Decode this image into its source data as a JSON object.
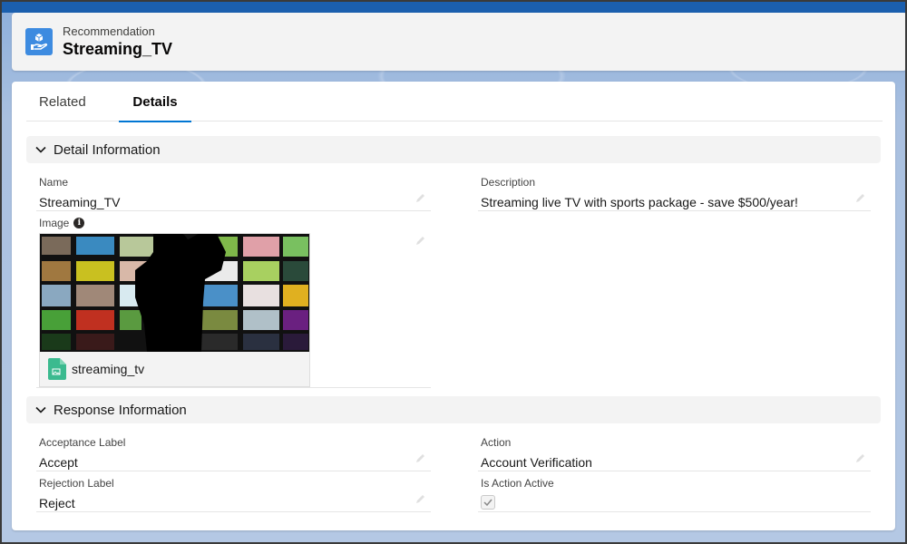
{
  "header": {
    "object_type": "Recommendation",
    "record_name": "Streaming_TV",
    "icon": "recommendation-icon",
    "icon_color": "#3d8be0"
  },
  "tabs": [
    {
      "label": "Related",
      "active": false
    },
    {
      "label": "Details",
      "active": true
    }
  ],
  "sections": {
    "detail": {
      "title": "Detail Information",
      "fields": {
        "name": {
          "label": "Name",
          "value": "Streaming_TV"
        },
        "description": {
          "label": "Description",
          "value": "Streaming live TV with sports package - save $500/year!"
        },
        "image": {
          "label": "Image",
          "info_icon": "info-icon",
          "file_name": "streaming_tv",
          "file_icon": "image-file-icon"
        }
      }
    },
    "response": {
      "title": "Response Information",
      "fields": {
        "acceptance_label": {
          "label": "Acceptance Label",
          "value": "Accept"
        },
        "rejection_label": {
          "label": "Rejection Label",
          "value": "Reject"
        },
        "action": {
          "label": "Action",
          "value": "Account Verification"
        },
        "is_action_active": {
          "label": "Is Action Active",
          "checked": true
        }
      }
    }
  },
  "colors": {
    "accent": "#0176d3",
    "section_bg": "#f3f3f3",
    "file_icon": "#3bba8f"
  }
}
